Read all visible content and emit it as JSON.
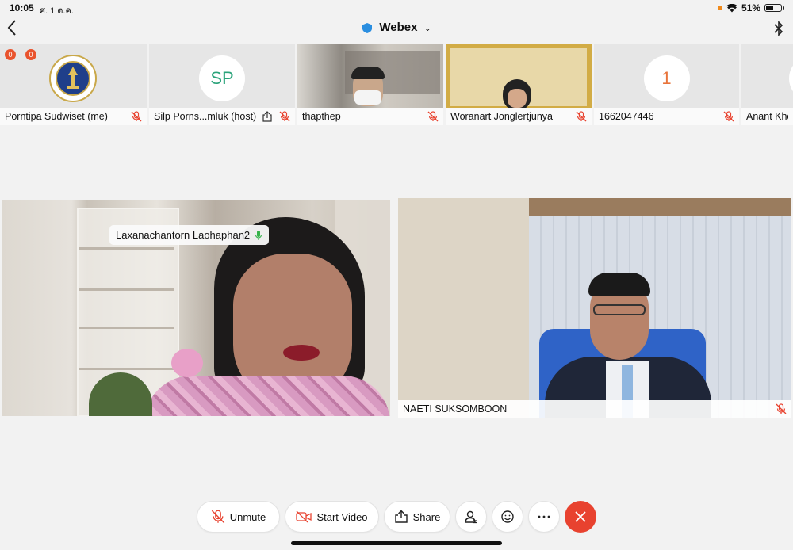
{
  "status": {
    "time": "10:05",
    "date": "ศ. 1 ต.ค.",
    "battery": "51%",
    "battery_level": 0.51
  },
  "nav": {
    "title": "Webex"
  },
  "participants": [
    {
      "name": "Porntipa Sudwiset (me)",
      "badges": [
        "0",
        "0"
      ]
    },
    {
      "name": "Silp Porns...mluk (host)",
      "initials": "SP"
    },
    {
      "name": "thapthep"
    },
    {
      "name": "Woranart Jonglertjunya"
    },
    {
      "name": "1662047446",
      "initials": "1"
    },
    {
      "name": "Anant Khos"
    }
  ],
  "videos": {
    "left": {
      "label": "Laxanachantorn Laohaphan2"
    },
    "right": {
      "name": "NAETI SUKSOMBOON"
    }
  },
  "controls": {
    "unmute": "Unmute",
    "start_video": "Start Video",
    "share": "Share"
  },
  "colors": {
    "accent_red": "#e8422f",
    "avatar_orange": "#e8743b",
    "avatar_green": "#2aa37a"
  }
}
